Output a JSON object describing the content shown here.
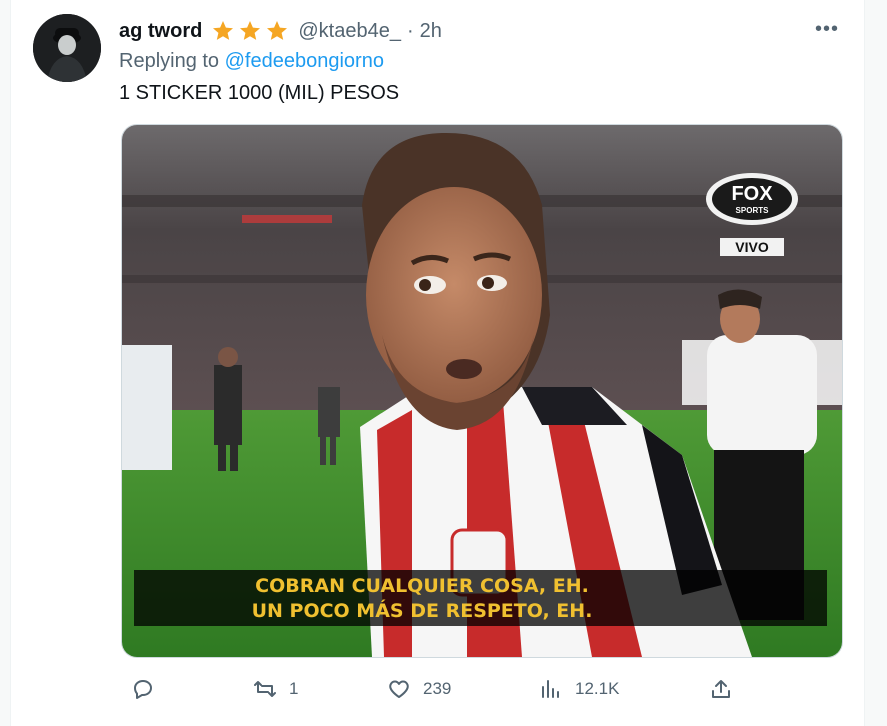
{
  "tweet": {
    "author_name": "ag tword",
    "badge_icon": "star-icon",
    "badge_count": 3,
    "handle": "@ktaeb4e_",
    "separator": "·",
    "time": "2h",
    "more_icon": "more-icon",
    "more_label": "•••",
    "replying_prefix": "Replying to",
    "replying_to": "@fedeebongiorno",
    "text": "1 STICKER 1000 (MIL) PESOS"
  },
  "media": {
    "broadcaster_logo": "FOX SPORTS",
    "live_label": "VIVO",
    "subtitle_line1": "COBRAN CUALQUIER COSA, EH.",
    "subtitle_line2": "UN POCO MÁS DE RESPETO, EH.",
    "colors": {
      "star": "#f5a623",
      "subtitle": "#f0c030",
      "pitch": "#3f8f2c"
    }
  },
  "actions": {
    "reply": {
      "icon": "reply-icon",
      "count": ""
    },
    "retweet": {
      "icon": "retweet-icon",
      "count": "1"
    },
    "like": {
      "icon": "heart-icon",
      "count": "239"
    },
    "views": {
      "icon": "views-icon",
      "count": "12.1K"
    },
    "share": {
      "icon": "share-icon",
      "count": ""
    }
  }
}
